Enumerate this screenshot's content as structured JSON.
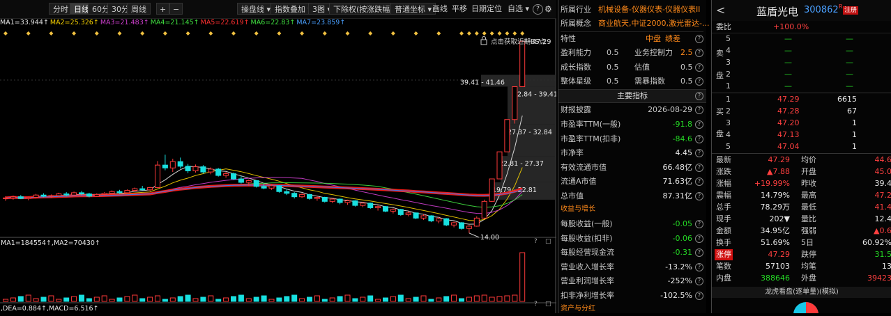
{
  "toolbar": {
    "periods": [
      "分时",
      "日线",
      "60分",
      "30分",
      "周线"
    ],
    "active_period": "日线",
    "plus": "+",
    "minus": "−",
    "buttons": [
      "操盘线",
      "指数叠加",
      "3图",
      "下除权(按涨跌幅)",
      "普通坐标",
      "画线",
      "平移",
      "日期定位",
      "自选"
    ]
  },
  "ma_line": [
    {
      "text": "MA1=33.944↑",
      "color": "#e8e8e8"
    },
    {
      "text": "MA2=25.326↑",
      "color": "#f5d000"
    },
    {
      "text": "MA3=21.483↑",
      "color": "#d040d0"
    },
    {
      "text": "MA4=21.145↑",
      "color": "#40e040"
    },
    {
      "text": "MA5=22.619↑",
      "color": "#ff3030"
    },
    {
      "text": "MA6=22.83↑",
      "color": "#40e040"
    },
    {
      "text": "MA7=23.859↑",
      "color": "#4aa0ff"
    }
  ],
  "chart_data": {
    "type": "candlestick",
    "price_high_label": "47.29",
    "price_low_label": "14.00",
    "bs_hint": "点击获取近期BS点",
    "ranges": [
      "39.41 - 41.46",
      "32.84 - 39.41",
      "27.37 - 32.84",
      "22.81 - 27.37",
      "19.79 - 22.81"
    ],
    "ohlc": [
      [
        20.0,
        20.4,
        19.6,
        20.1
      ],
      [
        20.1,
        20.5,
        19.8,
        20.3
      ],
      [
        20.3,
        20.6,
        19.9,
        20.0
      ],
      [
        20.0,
        20.3,
        19.7,
        20.2
      ],
      [
        20.2,
        20.8,
        20.0,
        20.6
      ],
      [
        20.6,
        20.9,
        20.2,
        20.4
      ],
      [
        20.4,
        20.7,
        20.1,
        20.5
      ],
      [
        20.5,
        21.0,
        20.3,
        20.8
      ],
      [
        20.8,
        21.1,
        20.4,
        20.6
      ],
      [
        20.6,
        21.2,
        20.5,
        21.0
      ],
      [
        21.0,
        21.3,
        20.6,
        20.8
      ],
      [
        20.8,
        21.0,
        20.2,
        20.4
      ],
      [
        20.4,
        20.9,
        20.3,
        20.7
      ],
      [
        20.7,
        21.1,
        20.5,
        20.9
      ],
      [
        20.9,
        21.4,
        20.7,
        21.2
      ],
      [
        21.2,
        21.5,
        20.8,
        21.0
      ],
      [
        21.0,
        21.6,
        20.9,
        21.4
      ],
      [
        21.4,
        21.9,
        21.2,
        21.7
      ],
      [
        21.7,
        22.2,
        21.4,
        21.5
      ],
      [
        21.5,
        22.0,
        21.3,
        21.9
      ],
      [
        21.9,
        26.5,
        21.8,
        25.8
      ],
      [
        25.8,
        27.6,
        24.9,
        25.3
      ],
      [
        25.3,
        26.9,
        24.6,
        26.4
      ],
      [
        26.4,
        27.1,
        25.2,
        25.6
      ],
      [
        25.6,
        26.0,
        24.4,
        24.8
      ],
      [
        24.8,
        25.9,
        24.5,
        25.5
      ],
      [
        25.5,
        25.8,
        24.3,
        24.6
      ],
      [
        24.6,
        25.4,
        24.2,
        25.1
      ],
      [
        25.1,
        25.3,
        23.8,
        24.0
      ],
      [
        24.0,
        24.6,
        23.6,
        24.3
      ],
      [
        24.3,
        24.5,
        23.2,
        23.4
      ],
      [
        23.4,
        23.9,
        22.6,
        22.8
      ],
      [
        22.8,
        23.3,
        22.2,
        23.1
      ],
      [
        23.1,
        23.2,
        21.9,
        22.1
      ],
      [
        22.1,
        22.6,
        21.6,
        21.8
      ],
      [
        21.8,
        22.4,
        21.5,
        22.2
      ],
      [
        22.2,
        22.3,
        21.0,
        21.2
      ],
      [
        21.2,
        21.7,
        20.6,
        20.9
      ],
      [
        20.9,
        21.1,
        20.0,
        20.3
      ],
      [
        20.3,
        20.9,
        20.1,
        20.7
      ],
      [
        20.7,
        20.8,
        19.8,
        20.0
      ],
      [
        20.0,
        20.5,
        19.6,
        20.2
      ],
      [
        20.2,
        20.3,
        19.3,
        19.5
      ],
      [
        19.5,
        20.1,
        19.2,
        19.9
      ],
      [
        19.9,
        20.0,
        19.0,
        19.3
      ],
      [
        19.3,
        19.8,
        18.9,
        19.6
      ],
      [
        19.6,
        19.7,
        18.6,
        18.8
      ],
      [
        18.8,
        19.4,
        18.5,
        19.2
      ],
      [
        19.2,
        19.3,
        18.2,
        18.4
      ],
      [
        18.4,
        18.9,
        17.9,
        18.6
      ],
      [
        18.6,
        18.7,
        17.6,
        17.8
      ],
      [
        17.8,
        18.3,
        17.4,
        18.1
      ],
      [
        18.1,
        18.2,
        17.0,
        17.2
      ],
      [
        17.2,
        17.8,
        16.9,
        17.5
      ],
      [
        17.5,
        17.6,
        16.4,
        16.6
      ],
      [
        16.6,
        17.3,
        16.3,
        17.0
      ],
      [
        17.0,
        17.1,
        15.9,
        16.1
      ],
      [
        16.1,
        16.8,
        15.7,
        16.5
      ],
      [
        16.5,
        16.6,
        15.2,
        15.4
      ],
      [
        15.4,
        16.0,
        15.0,
        15.8
      ],
      [
        15.8,
        15.9,
        14.6,
        14.8
      ],
      [
        14.8,
        15.4,
        14.0,
        15.2
      ],
      [
        15.2,
        16.9,
        15.1,
        16.6
      ],
      [
        16.6,
        19.8,
        16.5,
        19.5
      ],
      [
        19.5,
        23.4,
        19.4,
        23.4
      ],
      [
        23.4,
        28.1,
        23.4,
        28.1
      ],
      [
        28.1,
        33.7,
        28.1,
        33.7
      ],
      [
        33.7,
        39.4,
        33.0,
        39.4
      ],
      [
        39.4,
        47.29,
        39.4,
        47.29
      ]
    ],
    "volume_label": "MA1=184554↑,MA2=70430↑",
    "macd_label": ",DEA=0.884↑,MACD=6.516↑"
  },
  "info": {
    "industry_label": "所属行业",
    "industry_value": "机械设备-仪器仪表-仪器仪表II",
    "concept_label": "所属概念",
    "concept_value": "商业航天,中证2000,激光雷达-...",
    "traits_label": "特性",
    "traits_tags": [
      "中盘",
      "绩差"
    ],
    "scores": [
      {
        "l1": "盈利能力",
        "v1": "0.5",
        "l2": "业务控制力",
        "v2": "2.5"
      },
      {
        "l1": "成长指数",
        "v1": "0.5",
        "l2": "估值",
        "v2": "0.5"
      },
      {
        "l1": "整体星级",
        "v1": "0.5",
        "l2": "需暴指数",
        "v2": "0.5"
      }
    ],
    "main_title": "主要指标",
    "disclosure_label": "财报披露",
    "disclosure_value": "2026-08-29",
    "metrics": [
      {
        "label": "市盈率TTM(一般)",
        "value": "-91.8"
      },
      {
        "label": "市盈率TTM(扣非)",
        "value": "-84.6"
      },
      {
        "label": "市净率",
        "value": "4.45"
      },
      {
        "label": "有效流通市值",
        "value": "66.48亿"
      },
      {
        "label": "流通A市值",
        "value": "71.63亿"
      },
      {
        "label": "总市值",
        "value": "87.31亿"
      }
    ],
    "growth_title": "收益与增长",
    "growth": [
      {
        "label": "每股收益(一般)",
        "value": "-0.05"
      },
      {
        "label": "每股收益(扣非)",
        "value": "-0.06"
      },
      {
        "label": "每股经营现金流",
        "value": "-0.31"
      },
      {
        "label": "营业收入增长率",
        "value": "-13.2%"
      },
      {
        "label": "营业利润增长率",
        "value": "-252%"
      },
      {
        "label": "扣非净利增长率",
        "value": "-102.5%"
      }
    ],
    "assets_title": "资产与分红"
  },
  "quote": {
    "back": "<",
    "name": "蓝盾光电",
    "code": "300862",
    "badge": "R",
    "register": "注册",
    "wei_label": "委比",
    "wei_value": "+100.0%",
    "sell_side": [
      "卖",
      "盘"
    ],
    "buy_side": [
      "买",
      "盘"
    ],
    "asks": [
      {
        "lv": "5",
        "price": "—",
        "vol": "—"
      },
      {
        "lv": "4",
        "price": "—",
        "vol": "—"
      },
      {
        "lv": "3",
        "price": "—",
        "vol": "—"
      },
      {
        "lv": "2",
        "price": "—",
        "vol": "—"
      },
      {
        "lv": "1",
        "price": "—",
        "vol": "—"
      }
    ],
    "bids": [
      {
        "lv": "1",
        "price": "47.29",
        "vol": "6615"
      },
      {
        "lv": "2",
        "price": "47.28",
        "vol": "67"
      },
      {
        "lv": "3",
        "price": "47.20",
        "vol": "1"
      },
      {
        "lv": "4",
        "price": "47.13",
        "vol": "1"
      },
      {
        "lv": "5",
        "price": "47.04",
        "vol": "1"
      }
    ],
    "stats": [
      {
        "l1": "最新",
        "v1": "47.29",
        "c1": "red",
        "l2": "均价",
        "v2": "44.6",
        "c2": "red"
      },
      {
        "l1": "涨跌",
        "v1": "▲7.88",
        "c1": "red",
        "l2": "开盘",
        "v2": "45.0",
        "c2": "red"
      },
      {
        "l1": "涨幅",
        "v1": "+19.99%",
        "c1": "red",
        "l2": "昨收",
        "v2": "39.4",
        "c2": "white"
      },
      {
        "l1": "震幅",
        "v1": "14.79%",
        "c1": "white",
        "l2": "最高",
        "v2": "47.2",
        "c2": "red"
      },
      {
        "l1": "总手",
        "v1": "78.29万",
        "c1": "white",
        "l2": "最低",
        "v2": "41.4",
        "c2": "red"
      },
      {
        "l1": "现手",
        "v1": "202▼",
        "c1": "white",
        "l2": "量比",
        "v2": "12.4",
        "c2": "white"
      },
      {
        "l1": "金额",
        "v1": "34.95亿",
        "c1": "white",
        "l2": "强弱",
        "v2": "▲0.6",
        "c2": "red"
      },
      {
        "l1": "换手",
        "v1": "51.69%",
        "c1": "white",
        "l2": "5日",
        "v2": "60.92%",
        "c2": "white"
      },
      {
        "l1": "涨停",
        "v1": "47.29",
        "c1": "red",
        "l2": "跌停",
        "v2": "31.5",
        "c2": "green"
      },
      {
        "l1": "笔数",
        "v1": "57103",
        "c1": "white",
        "l2": "均笔",
        "v2": "13",
        "c2": "white"
      },
      {
        "l1": "内盘",
        "v1": "388646",
        "c1": "green",
        "l2": "外盘",
        "v2": "39423",
        "c2": "red"
      }
    ],
    "dragon_title": "龙虎看盘(逐单量)(模拟)",
    "colors": {
      "up": "#ff3a3a",
      "down": "#18e0e0",
      "accent": "#e01010"
    }
  }
}
